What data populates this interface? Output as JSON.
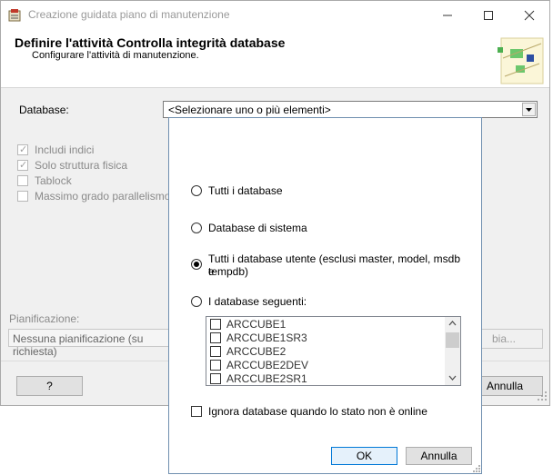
{
  "window": {
    "title": "Creazione guidata piano di manutenzione",
    "minimize_icon": "minimize-icon",
    "maximize_icon": "maximize-icon",
    "close_icon": "close-icon"
  },
  "header": {
    "title": "Definire l'attività Controlla integrità database",
    "subtitle": "Configurare l'attività di manutenzione."
  },
  "form": {
    "database_label": "Database:",
    "database_value": "<Selezionare uno o più elementi>",
    "options": [
      {
        "label": "Includi indici",
        "checked": true
      },
      {
        "label": "Solo struttura fisica",
        "checked": true
      },
      {
        "label": "Tablock",
        "checked": false
      },
      {
        "label": "Massimo grado parallelismo",
        "checked": false
      }
    ],
    "schedule_label": "Pianificazione:",
    "schedule_value": "Nessuna pianificazione (su richiesta)",
    "change_button": "bia..."
  },
  "footer": {
    "help_button": "?",
    "cancel_button": "Annulla"
  },
  "popup": {
    "radio_all": "Tutti i database",
    "radio_system": "Database di sistema",
    "radio_user_line1": "Tutti i database utente (esclusi master, model, msdb e",
    "radio_user_line2": "tempdb)",
    "radio_following": "I database seguenti:",
    "selected_radio": "user",
    "databases": [
      "ARCCUBE1",
      "ARCCUBE1SR3",
      "ARCCUBE2",
      "ARCCUBE2DEV",
      "ARCCUBE2SR1"
    ],
    "ignore_offline": "Ignora database quando lo stato non è online",
    "ok_button": "OK",
    "cancel_button": "Annulla"
  }
}
